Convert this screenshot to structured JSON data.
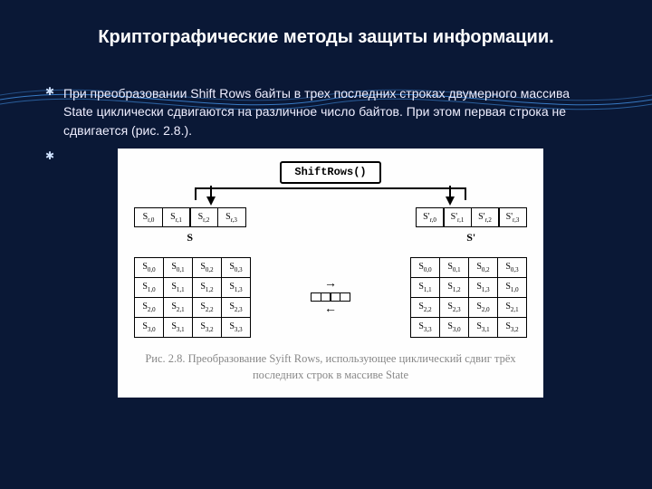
{
  "title": "Криптографические методы защиты информации.",
  "bullet1": "При преобразовании Shift Rows байты в трех последних строках двумерного массива State циклически сдвигаются на различное число байтов. При этом первая строка не сдвигается (рис. 2.8.).",
  "shift_label": "ShiftRows()",
  "state_s": "S",
  "state_sp": "S'",
  "row_in": {
    "c0": "Sr,0",
    "c1": "Sr,1",
    "c2": "Sr,2",
    "c3": "Sr,3"
  },
  "row_out": {
    "c0": "S'r,0",
    "c1": "S'r,1",
    "c2": "S'r,2",
    "c3": "S'r,3"
  },
  "matrix_in": [
    [
      "S0,0",
      "S0,1",
      "S0,2",
      "S0,3"
    ],
    [
      "S1,0",
      "S1,1",
      "S1,2",
      "S1,3"
    ],
    [
      "S2,0",
      "S2,1",
      "S2,2",
      "S2,3"
    ],
    [
      "S3,0",
      "S3,1",
      "S3,2",
      "S3,3"
    ]
  ],
  "matrix_out": [
    [
      "S0,0",
      "S0,1",
      "S0,2",
      "S0,3"
    ],
    [
      "S1,1",
      "S1,2",
      "S1,3",
      "S1,0"
    ],
    [
      "S2,2",
      "S2,3",
      "S2,0",
      "S2,1"
    ],
    [
      "S3,3",
      "S3,0",
      "S3,1",
      "S3,2"
    ]
  ],
  "caption": "Рис. 2.8. Преобразование Syift Rows, использующее циклический сдвиг трёх последних строк в массиве State",
  "chart_data": {
    "type": "table",
    "title": "ShiftRows on State array",
    "input_row_r": [
      "S_{r,0}",
      "S_{r,1}",
      "S_{r,2}",
      "S_{r,3}"
    ],
    "output_row_r": [
      "S'_{r,0}",
      "S'_{r,1}",
      "S'_{r,2}",
      "S'_{r,3}"
    ],
    "input_matrix": [
      [
        "S_{0,0}",
        "S_{0,1}",
        "S_{0,2}",
        "S_{0,3}"
      ],
      [
        "S_{1,0}",
        "S_{1,1}",
        "S_{1,2}",
        "S_{1,3}"
      ],
      [
        "S_{2,0}",
        "S_{2,1}",
        "S_{2,2}",
        "S_{2,3}"
      ],
      [
        "S_{3,0}",
        "S_{3,1}",
        "S_{3,2}",
        "S_{3,3}"
      ]
    ],
    "output_matrix": [
      [
        "S_{0,0}",
        "S_{0,1}",
        "S_{0,2}",
        "S_{0,3}"
      ],
      [
        "S_{1,1}",
        "S_{1,2}",
        "S_{1,3}",
        "S_{1,0}"
      ],
      [
        "S_{2,2}",
        "S_{2,3}",
        "S_{2,0}",
        "S_{2,1}"
      ],
      [
        "S_{3,3}",
        "S_{3,0}",
        "S_{3,1}",
        "S_{3,2}"
      ]
    ],
    "row_shifts": [
      0,
      1,
      2,
      3
    ]
  }
}
